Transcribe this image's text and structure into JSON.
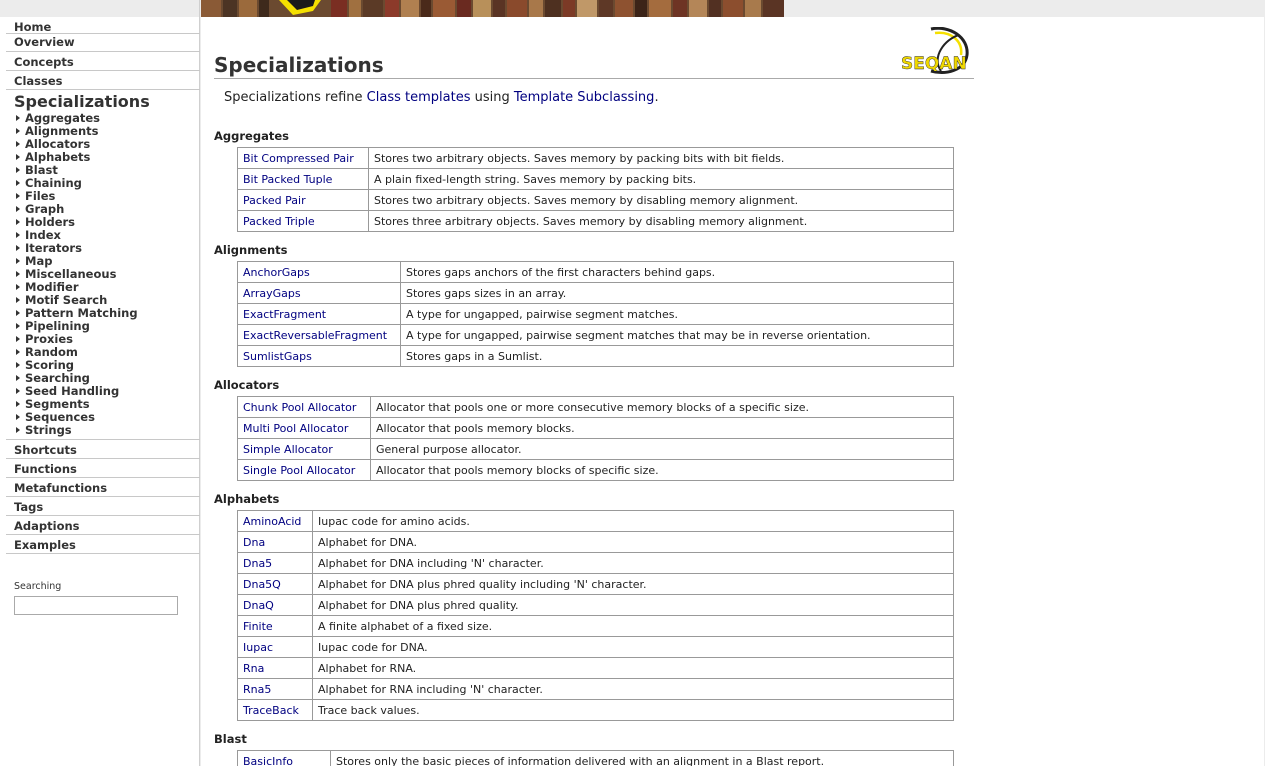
{
  "nav": {
    "top_items": [
      "Home",
      "Overview",
      "Concepts",
      "Classes"
    ],
    "specializations_label": "Specializations",
    "specializations_items": [
      "Aggregates",
      "Alignments",
      "Allocators",
      "Alphabets",
      "Blast",
      "Chaining",
      "Files",
      "Graph",
      "Holders",
      "Index",
      "Iterators",
      "Map",
      "Miscellaneous",
      "Modifier",
      "Motif Search",
      "Pattern Matching",
      "Pipelining",
      "Proxies",
      "Random",
      "Scoring",
      "Searching",
      "Seed Handling",
      "Segments",
      "Sequences",
      "Strings"
    ],
    "bottom_items": [
      "Shortcuts",
      "Functions",
      "Metafunctions",
      "Tags",
      "Adaptions",
      "Examples"
    ],
    "search_label": "Searching",
    "search_value": ""
  },
  "logo_text": "SEQAN",
  "page": {
    "title": "Specializations",
    "intro_prefix": "Specializations refine ",
    "intro_link1": "Class templates",
    "intro_middle": " using ",
    "intro_link2": "Template Subclassing",
    "intro_suffix": "."
  },
  "sections": [
    {
      "title": "Aggregates",
      "rows": [
        {
          "name": "Bit Compressed Pair",
          "desc": "Stores two arbitrary objects. Saves memory by packing bits with bit fields."
        },
        {
          "name": "Bit Packed Tuple",
          "desc": "A plain fixed-length string. Saves memory by packing bits."
        },
        {
          "name": "Packed Pair",
          "desc": "Stores two arbitrary objects. Saves memory by disabling memory alignment."
        },
        {
          "name": "Packed Triple",
          "desc": "Stores three arbitrary objects. Saves memory by disabling memory alignment."
        }
      ]
    },
    {
      "title": "Alignments",
      "rows": [
        {
          "name": "AnchorGaps",
          "desc": "Stores gaps anchors of the first characters behind gaps."
        },
        {
          "name": "ArrayGaps",
          "desc": "Stores gaps sizes in an array."
        },
        {
          "name": "ExactFragment",
          "desc": "A type for ungapped, pairwise segment matches."
        },
        {
          "name": "ExactReversableFragment",
          "desc": "A type for ungapped, pairwise segment matches that may be in reverse orientation."
        },
        {
          "name": "SumlistGaps",
          "desc": "Stores gaps in a Sumlist."
        }
      ]
    },
    {
      "title": "Allocators",
      "rows": [
        {
          "name": "Chunk Pool Allocator",
          "desc": "Allocator that pools one or more consecutive memory blocks of a specific size."
        },
        {
          "name": "Multi Pool Allocator",
          "desc": "Allocator that pools memory blocks."
        },
        {
          "name": "Simple Allocator",
          "desc": "General purpose allocator."
        },
        {
          "name": "Single Pool Allocator",
          "desc": "Allocator that pools memory blocks of specific size."
        }
      ]
    },
    {
      "title": "Alphabets",
      "rows": [
        {
          "name": "AminoAcid",
          "desc": "Iupac code for amino acids."
        },
        {
          "name": "Dna",
          "desc": "Alphabet for DNA."
        },
        {
          "name": "Dna5",
          "desc": "Alphabet for DNA including 'N' character."
        },
        {
          "name": "Dna5Q",
          "desc": "Alphabet for DNA plus phred quality including 'N' character."
        },
        {
          "name": "DnaQ",
          "desc": "Alphabet for DNA plus phred quality."
        },
        {
          "name": "Finite",
          "desc": "A finite alphabet of a fixed size."
        },
        {
          "name": "Iupac",
          "desc": "Iupac code for DNA."
        },
        {
          "name": "Rna",
          "desc": "Alphabet for RNA."
        },
        {
          "name": "Rna5",
          "desc": "Alphabet for RNA including 'N' character."
        },
        {
          "name": "TraceBack",
          "desc": "Trace back values."
        }
      ]
    },
    {
      "title": "Blast",
      "rows": [
        {
          "name": "BasicInfo",
          "desc": "Stores only the basic pieces of information delivered with an alignment in a Blast report."
        }
      ]
    }
  ],
  "colors": {
    "link": "#000080",
    "border": "#999999"
  }
}
